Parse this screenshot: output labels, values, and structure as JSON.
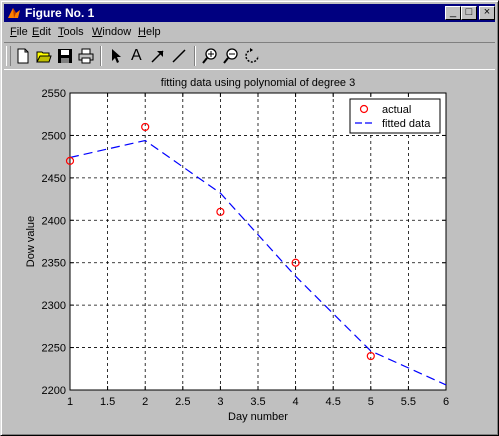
{
  "window": {
    "title": "Figure No. 1",
    "buttons": {
      "minimize": "_",
      "maximize": "□",
      "close": "×"
    }
  },
  "menu": {
    "items": [
      {
        "label": "File",
        "accel": "F",
        "rest": "ile"
      },
      {
        "label": "Edit",
        "accel": "E",
        "rest": "dit"
      },
      {
        "label": "Tools",
        "accel": "T",
        "rest": "ools"
      },
      {
        "label": "Window",
        "accel": "W",
        "rest": "indow"
      },
      {
        "label": "Help",
        "accel": "H",
        "rest": "elp"
      }
    ]
  },
  "toolbar": {
    "tools": [
      "new-file-icon",
      "open-folder-icon",
      "save-icon",
      "print-icon",
      "arrow-cursor-icon",
      "text-tool-icon",
      "arrow-tool-icon",
      "line-tool-icon",
      "zoom-in-icon",
      "zoom-out-icon",
      "rotate-icon"
    ],
    "text_tool_glyph": "A"
  },
  "chart_data": {
    "type": "line",
    "title": "fitting data using polynomial of degree 3",
    "xlabel": "Day number",
    "ylabel": "Dow value",
    "xlim": [
      1,
      6
    ],
    "ylim": [
      2200,
      2550
    ],
    "xticks": [
      "1",
      "1.5",
      "2",
      "2.5",
      "3",
      "3.5",
      "4",
      "4.5",
      "5",
      "5.5",
      "6"
    ],
    "yticks": [
      "2200",
      "2250",
      "2300",
      "2350",
      "2400",
      "2450",
      "2500",
      "2550"
    ],
    "grid": true,
    "legend_position": "top-right",
    "series": [
      {
        "name": "actual",
        "style": "markers",
        "marker": "circle",
        "color": "#ff0000",
        "x": [
          1,
          2,
          3,
          4,
          5
        ],
        "y": [
          2470,
          2510,
          2410,
          2350,
          2240
        ]
      },
      {
        "name": "fitted data",
        "style": "dashed",
        "color": "#0000ff",
        "x": [
          1,
          2,
          3,
          4,
          5,
          6
        ],
        "y": [
          2474,
          2494,
          2432,
          2334,
          2246,
          2206
        ]
      }
    ]
  }
}
